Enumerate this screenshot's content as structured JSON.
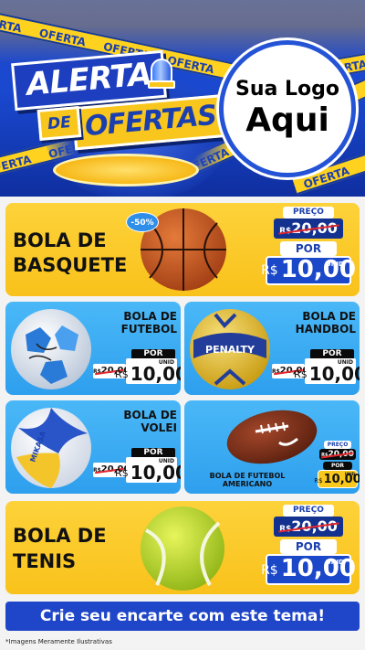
{
  "header": {
    "title_line1": "ALERTA",
    "title_de": "DE",
    "title_line2": "OFERTAS",
    "tape_text": "OFERTA",
    "logo_line1": "Sua Logo",
    "logo_line2": "Aqui",
    "brand_blue": "#1f46c8",
    "brand_yellow": "#f8c61c"
  },
  "products": {
    "basquete": {
      "name": "BOLA DE BASQUETE",
      "discount": "-50%",
      "price_label": "PREÇO",
      "old_currency": "R$",
      "old_value": "20,00",
      "por_label": "POR",
      "currency": "R$",
      "new_value": "10,00",
      "unit": "UNID",
      "icon": "basketball-icon"
    },
    "futebol": {
      "name": "BOLA DE FUTEBOL",
      "por_label": "POR",
      "old_currency": "R$",
      "old_value": "20,00",
      "currency": "R$",
      "new_value": "10,00",
      "unit": "UNID",
      "icon": "soccer-ball-icon"
    },
    "handbol": {
      "name": "BOLA DE HANDBOL",
      "por_label": "POR",
      "old_currency": "R$",
      "old_value": "20,00",
      "currency": "R$",
      "new_value": "10,00",
      "unit": "UNID",
      "brand": "PENALTY",
      "icon": "handball-icon"
    },
    "volei": {
      "name": "BOLA DE VOLEI",
      "por_label": "POR",
      "old_currency": "R$",
      "old_value": "20,00",
      "currency": "R$",
      "new_value": "10,00",
      "unit": "UNID",
      "brand": "MIKASA",
      "icon": "volleyball-icon"
    },
    "americano": {
      "name": "BOLA DE FUTEBOL AMERICANO",
      "price_label": "PREÇO",
      "old_currency": "R$",
      "old_value": "20,00",
      "por_label": "POR",
      "currency": "R$",
      "new_value": "10,00",
      "unit": "UNID",
      "icon": "american-football-icon"
    },
    "tenis": {
      "name": "BOLA DE TENIS",
      "price_label": "PREÇO",
      "old_currency": "R$",
      "old_value": "20,00",
      "por_label": "POR",
      "currency": "R$",
      "new_value": "10,00",
      "unit": "UNID",
      "icon": "tennis-ball-icon"
    }
  },
  "cta": "Crie seu encarte com este tema!",
  "footnote": "*Imagens Meramente Ilustrativas"
}
